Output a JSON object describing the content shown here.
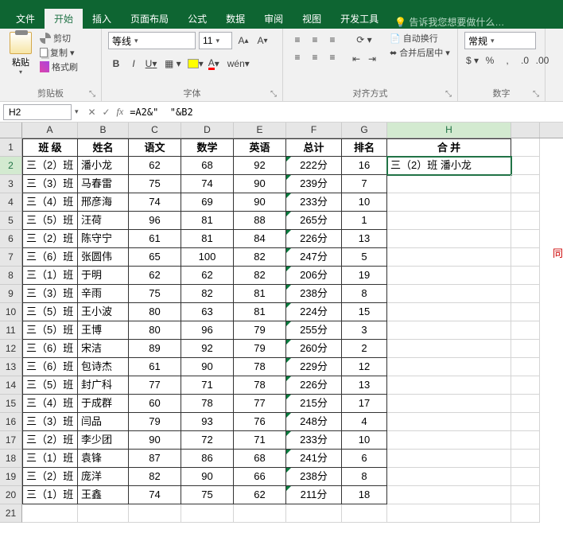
{
  "tabs": {
    "file": "文件",
    "home": "开始",
    "insert": "插入",
    "layout": "页面布局",
    "formulas": "公式",
    "data": "数据",
    "review": "审阅",
    "view": "视图",
    "dev": "开发工具",
    "tell_me": "告诉我您想要做什么…"
  },
  "ribbon": {
    "clipboard": {
      "label": "剪贴板",
      "paste": "粘贴",
      "cut": "剪切",
      "copy": "复制",
      "brush": "格式刷"
    },
    "font": {
      "label": "字体",
      "family": "等线",
      "size": "11",
      "bold": "B",
      "italic": "I",
      "underline": "U",
      "wen": "wén"
    },
    "align": {
      "label": "对齐方式",
      "wrap": "自动换行",
      "merge": "合并后居中"
    },
    "number": {
      "label": "数字",
      "format": "常规"
    }
  },
  "name_box": "H2",
  "formula": "=A2&\"  \"&B2",
  "columns": [
    "A",
    "B",
    "C",
    "D",
    "E",
    "F",
    "G",
    "H"
  ],
  "headers": {
    "A": "班  级",
    "B": "姓名",
    "C": "语文",
    "D": "数学",
    "E": "英语",
    "F": "总计",
    "G": "排名",
    "H": "合    并"
  },
  "h2_value": "三（2）班 潘小龙",
  "rows": [
    {
      "cls": "三（2）班",
      "name": "潘小龙",
      "yw": 62,
      "sx": 68,
      "yy": 92,
      "total": "222分",
      "rank": 16
    },
    {
      "cls": "三（3）班",
      "name": "马春雷",
      "yw": 75,
      "sx": 74,
      "yy": 90,
      "total": "239分",
      "rank": 7
    },
    {
      "cls": "三（4）班",
      "name": "邢彦海",
      "yw": 74,
      "sx": 69,
      "yy": 90,
      "total": "233分",
      "rank": 10
    },
    {
      "cls": "三（5）班",
      "name": "汪荷",
      "yw": 96,
      "sx": 81,
      "yy": 88,
      "total": "265分",
      "rank": 1
    },
    {
      "cls": "三（2）班",
      "name": "陈守宁",
      "yw": 61,
      "sx": 81,
      "yy": 84,
      "total": "226分",
      "rank": 13
    },
    {
      "cls": "三（6）班",
      "name": "张圆伟",
      "yw": 65,
      "sx": 100,
      "yy": 82,
      "total": "247分",
      "rank": 5
    },
    {
      "cls": "三（1）班",
      "name": "于明",
      "yw": 62,
      "sx": 62,
      "yy": 82,
      "total": "206分",
      "rank": 19
    },
    {
      "cls": "三（3）班",
      "name": "辛雨",
      "yw": 75,
      "sx": 82,
      "yy": 81,
      "total": "238分",
      "rank": 8
    },
    {
      "cls": "三（5）班",
      "name": "王小波",
      "yw": 80,
      "sx": 63,
      "yy": 81,
      "total": "224分",
      "rank": 15
    },
    {
      "cls": "三（5）班",
      "name": "王博",
      "yw": 80,
      "sx": 96,
      "yy": 79,
      "total": "255分",
      "rank": 3
    },
    {
      "cls": "三（6）班",
      "name": "宋洁",
      "yw": 89,
      "sx": 92,
      "yy": 79,
      "total": "260分",
      "rank": 2
    },
    {
      "cls": "三（6）班",
      "name": "包诗杰",
      "yw": 61,
      "sx": 90,
      "yy": 78,
      "total": "229分",
      "rank": 12
    },
    {
      "cls": "三（5）班",
      "name": "封广科",
      "yw": 77,
      "sx": 71,
      "yy": 78,
      "total": "226分",
      "rank": 13
    },
    {
      "cls": "三（4）班",
      "name": "于成群",
      "yw": 60,
      "sx": 78,
      "yy": 77,
      "total": "215分",
      "rank": 17
    },
    {
      "cls": "三（3）班",
      "name": "闫品",
      "yw": 79,
      "sx": 93,
      "yy": 76,
      "total": "248分",
      "rank": 4
    },
    {
      "cls": "三（2）班",
      "name": "李少团",
      "yw": 90,
      "sx": 72,
      "yy": 71,
      "total": "233分",
      "rank": 10
    },
    {
      "cls": "三（1）班",
      "name": "袁锋",
      "yw": 87,
      "sx": 86,
      "yy": 68,
      "total": "241分",
      "rank": 6
    },
    {
      "cls": "三（2）班",
      "name": "庞洋",
      "yw": 82,
      "sx": 90,
      "yy": 66,
      "total": "238分",
      "rank": 8
    },
    {
      "cls": "三（1）班",
      "name": "王鑫",
      "yw": 74,
      "sx": 75,
      "yy": 62,
      "total": "211分",
      "rank": 18
    }
  ],
  "side_note": "同"
}
